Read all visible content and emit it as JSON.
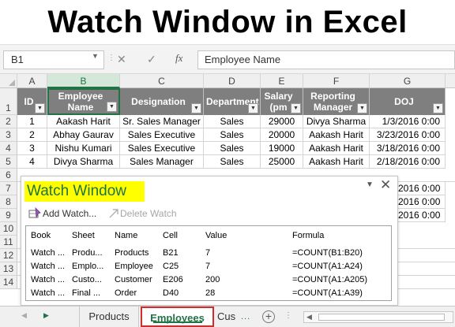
{
  "banner": {
    "title": "Watch Window in Excel"
  },
  "formula_bar": {
    "name_box": "B1",
    "cancel_symbol": "✕",
    "enter_symbol": "✓",
    "fx_label": "fx",
    "formula_value": "Employee Name"
  },
  "columns": [
    "A",
    "B",
    "C",
    "D",
    "E",
    "F",
    "G"
  ],
  "rows": [
    "1",
    "2",
    "3",
    "4",
    "5",
    "6",
    "7",
    "8",
    "9",
    "10",
    "11",
    "12",
    "13",
    "14"
  ],
  "table": {
    "headers": [
      {
        "line1": "ID",
        "line2": ""
      },
      {
        "line1": "Employee",
        "line2": "Name"
      },
      {
        "line1": "Designation",
        "line2": ""
      },
      {
        "line1": "Department",
        "line2": ""
      },
      {
        "line1": "Salary",
        "line2": "(pm"
      },
      {
        "line1": "Reporting",
        "line2": "Manager"
      },
      {
        "line1": "DOJ",
        "line2": ""
      }
    ],
    "rows": [
      {
        "id": "1",
        "name": "Aakash Harit",
        "designation": "Sr. Sales Manager",
        "department": "Sales",
        "salary": "29000",
        "manager": "Divya Sharma",
        "doj": "1/3/2016 0:00"
      },
      {
        "id": "2",
        "name": "Abhay Gaurav",
        "designation": "Sales Executive",
        "department": "Sales",
        "salary": "20000",
        "manager": "Aakash Harit",
        "doj": "3/23/2016 0:00"
      },
      {
        "id": "3",
        "name": "Nishu Kumari",
        "designation": "Sales Executive",
        "department": "Sales",
        "salary": "19000",
        "manager": "Aakash Harit",
        "doj": "3/18/2016 0:00"
      },
      {
        "id": "4",
        "name": "Divya Sharma",
        "designation": "Sales Manager",
        "department": "Sales",
        "salary": "25000",
        "manager": "Aakash Harit",
        "doj": "2/18/2016 0:00"
      }
    ],
    "partial_doj": [
      "2016 0:00",
      "2016 0:00",
      "2016 0:00"
    ]
  },
  "watch_window": {
    "title": "Watch Window",
    "add_watch": "Add Watch...",
    "delete_watch": "Delete Watch",
    "headers": [
      "Book",
      "Sheet",
      "Name",
      "Cell",
      "Value",
      "Formula"
    ],
    "rows": [
      {
        "book": "Watch ...",
        "sheet": "Produ...",
        "name": "Products",
        "cell": "B21",
        "value": "7",
        "formula": "=COUNT(B1:B20)"
      },
      {
        "book": "Watch ...",
        "sheet": "Emplo...",
        "name": "Employee",
        "cell": "C25",
        "value": "7",
        "formula": "=COUNT(A1:A24)"
      },
      {
        "book": "Watch ...",
        "sheet": "Custo...",
        "name": "Customer",
        "cell": "E206",
        "value": "200",
        "formula": "=COUNT(A1:A205)"
      },
      {
        "book": "Watch ...",
        "sheet": "Final ...",
        "name": "Order",
        "cell": "D40",
        "value": "28",
        "formula": "=COUNT(A1:A39)"
      }
    ]
  },
  "sheet_tabs": {
    "tabs": [
      "Products",
      "Employees",
      "Cus"
    ],
    "active": "Employees",
    "more": "...",
    "add": "+"
  },
  "colors": {
    "header_fill": "#7f7f7f",
    "excel_green": "#217346",
    "highlight": "#ffff00",
    "active_tab_border": "#d62b2b"
  }
}
